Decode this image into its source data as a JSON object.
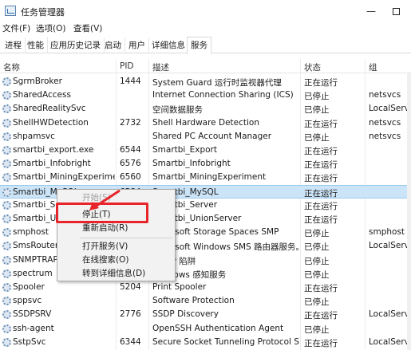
{
  "window": {
    "title": "任务管理器",
    "minimize": "—"
  },
  "menu": [
    "文件(F)",
    "选项(O)",
    "查看(V)"
  ],
  "tabs": [
    "进程",
    "性能",
    "应用历史记录",
    "启动",
    "用户",
    "详细信息",
    "服务"
  ],
  "active_tab": "服务",
  "columns": {
    "name": "名称",
    "pid": "PID",
    "desc": "描述",
    "status": "状态",
    "group": "组"
  },
  "rows": [
    {
      "name": "SgrmBroker",
      "pid": "1444",
      "desc": "System Guard 运行时监视器代理",
      "status": "正在运行",
      "group": ""
    },
    {
      "name": "SharedAccess",
      "pid": "",
      "desc": "Internet Connection Sharing (ICS)",
      "status": "已停止",
      "group": "netsvcs"
    },
    {
      "name": "SharedRealitySvc",
      "pid": "",
      "desc": "空间数据服务",
      "status": "已停止",
      "group": "LocalService"
    },
    {
      "name": "ShellHWDetection",
      "pid": "2732",
      "desc": "Shell Hardware Detection",
      "status": "正在运行",
      "group": "netsvcs"
    },
    {
      "name": "shpamsvc",
      "pid": "",
      "desc": "Shared PC Account Manager",
      "status": "已停止",
      "group": "netsvcs"
    },
    {
      "name": "smartbi_export.exe",
      "pid": "6544",
      "desc": "Smartbi_Export",
      "status": "正在运行",
      "group": ""
    },
    {
      "name": "Smartbi_Infobright",
      "pid": "6576",
      "desc": "Smartbi_Infobright",
      "status": "正在运行",
      "group": ""
    },
    {
      "name": "Smartbi_MiningExperime...",
      "pid": "6560",
      "desc": "Smartbi_MiningExperiment",
      "status": "正在运行",
      "group": ""
    },
    {
      "name": "Smartbi_MySQL",
      "pid": "6584",
      "desc": "Smartbi_MySQL",
      "status": "正在运行",
      "group": ""
    },
    {
      "name": "Smartbi_Server",
      "pid": "",
      "desc": "Smartbi_Server",
      "status": "正在运行",
      "group": ""
    },
    {
      "name": "Smartbi_UnionServer",
      "pid": "",
      "desc": "Smartbi_UnionServer",
      "status": "正在运行",
      "group": ""
    },
    {
      "name": "smphost",
      "pid": "",
      "desc": "Microsoft Storage Spaces SMP",
      "status": "已停止",
      "group": "smphost"
    },
    {
      "name": "SmsRouter",
      "pid": "",
      "desc": "Microsoft Windows SMS 路由器服务。",
      "status": "已停止",
      "group": "LocalServic"
    },
    {
      "name": "SNMPTRAP",
      "pid": "",
      "desc": "SNMP 陷阱",
      "status": "已停止",
      "group": ""
    },
    {
      "name": "spectrum",
      "pid": "",
      "desc": "Windows 感知服务",
      "status": "已停止",
      "group": ""
    },
    {
      "name": "Spooler",
      "pid": "5204",
      "desc": "Print Spooler",
      "status": "正在运行",
      "group": ""
    },
    {
      "name": "sppsvc",
      "pid": "",
      "desc": "Software Protection",
      "status": "已停止",
      "group": ""
    },
    {
      "name": "SSDPSRV",
      "pid": "2776",
      "desc": "SSDP Discovery",
      "status": "正在运行",
      "group": "LocalServic"
    },
    {
      "name": "ssh-agent",
      "pid": "",
      "desc": "OpenSSH Authentication Agent",
      "status": "已停止",
      "group": ""
    },
    {
      "name": "SstpSvc",
      "pid": "6344",
      "desc": "Secure Socket Tunneling Protocol S...",
      "status": "正在运行",
      "group": "LocalServic"
    }
  ],
  "context_menu": {
    "start": "开始(S)",
    "stop": "停止(T)",
    "restart": "重新启动(R)",
    "open_services": "打开服务(V)",
    "search_online": "在线搜索(O)",
    "goto_details": "转到详细信息(D)"
  },
  "colors": {
    "selected_row": "#cce4f7",
    "highlight": "#e8252b"
  }
}
